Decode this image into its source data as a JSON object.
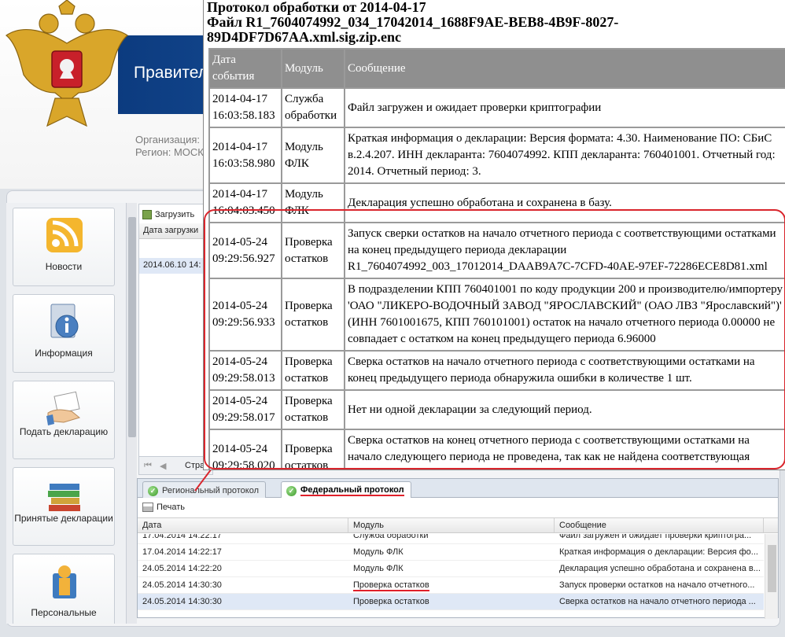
{
  "header": {
    "banner_title": "Правител",
    "org_line": "Организация:",
    "region_line": "Регион: МОСК"
  },
  "sidebar": {
    "items": [
      {
        "label": "Новости",
        "icon": "rss-icon"
      },
      {
        "label": "Информация",
        "icon": "info-icon"
      },
      {
        "label": "Подать декларацию",
        "icon": "hand-document-icon"
      },
      {
        "label": "Принятые декларации",
        "icon": "books-icon"
      },
      {
        "label": "Персональные",
        "icon": "person-icon"
      }
    ]
  },
  "top_grid": {
    "upload_label": "Загрузить",
    "column_header": "Дата загрузки",
    "row_value": "2014.06.10 14:",
    "pager_text": "Стра"
  },
  "bottom_panel": {
    "tabs": [
      {
        "label": "Региональный протокол",
        "active": false
      },
      {
        "label": "Федеральный протокол",
        "active": true
      }
    ],
    "print_label": "Печать",
    "columns": [
      "Дата",
      "Модуль",
      "Сообщение"
    ],
    "rows": [
      {
        "date": "17.04.2014 14:22:17",
        "module": "Служба обработки",
        "message": "Файл загружен и ожидает проверки криптогра..."
      },
      {
        "date": "17.04.2014 14:22:17",
        "module": "Модуль ФЛК",
        "message": "Краткая информация о декларации: Версия фо..."
      },
      {
        "date": "24.05.2014 14:22:20",
        "module": "Модуль ФЛК",
        "message": "Декларация успешно обработана и сохранена в..."
      },
      {
        "date": "24.05.2014 14:30:30",
        "module": "Проверка остатков",
        "message": "Запуск проверки остатков на начало отчетного..."
      },
      {
        "date": "24.05.2014 14:30:30",
        "module": "Проверка остатков",
        "message": "Сверка остатков на начало отчетного периода ..."
      }
    ]
  },
  "popup": {
    "title_line1": "Протокол обработки от 2014-04-17",
    "title_line2": "Файл R1_7604074992_034_17042014_1688F9AE-BEB8-4B9F-8027-",
    "title_line3": "89D4DF7D67AA.xml.sig.zip.enc",
    "columns": [
      "Дата события",
      "Модуль",
      "Сообщение"
    ],
    "rows": [
      {
        "date": "2014-04-17 16:03:58.183",
        "module": "Служба обработки",
        "message": "Файл загружен и ожидает проверки криптографии"
      },
      {
        "date": "2014-04-17 16:03:58.980",
        "module": "Модуль ФЛК",
        "message": "Краткая информация о декларации: Версия формата: 4.30. Наименование ПО: СБиС в.2.4.207. ИНН декларанта: 7604074992. КПП декларанта: 760401001. Отчетный год: 2014. Отчетный период: 3."
      },
      {
        "date": "2014-04-17 16:04:03.450",
        "module": "Модуль ФЛК",
        "message": "Декларация успешно обработана и сохранена в базу."
      },
      {
        "date": "2014-05-24 09:29:56.927",
        "module": "Проверка остатков",
        "message": "Запуск сверки остатков на начало отчетного периода с соответствующими остатками на конец предыдущего периода декларации R1_7604074992_003_17012014_DAAB9A7C-7CFD-40AE-97EF-72286ECE8D81.xml"
      },
      {
        "date": "2014-05-24 09:29:56.933",
        "module": "Проверка остатков",
        "message": "В подразделении КПП 760401001 по коду продукции 200 и производителю/импортеру 'ОАО \"ЛИКЕРО-ВОДОЧНЫЙ ЗАВОД \"ЯРОСЛАВСКИЙ\" (ОАО ЛВЗ \"Ярославский\")' (ИНН 7601001675, КПП 760101001) остаток на начало отчетного периода 0.00000 не совпадает с остатком на конец предыдущего периода 6.96000"
      },
      {
        "date": "2014-05-24 09:29:58.013",
        "module": "Проверка остатков",
        "message": "Сверка остатков на начало отчетного периода с соответствующими остатками на конец предыдущего периода обнаружила ошибки в количестве 1 шт."
      },
      {
        "date": "2014-05-24 09:29:58.017",
        "module": "Проверка остатков",
        "message": "Нет ни одной декларации за следующий период."
      },
      {
        "date": "2014-05-24 09:29:58.020",
        "module": "Проверка остатков",
        "message": "Сверка остатков на конец отчетного периода с соответствующими остатками на начало следующего периода не проведена, так как не найдена соответствующая декларация."
      }
    ]
  },
  "colors": {
    "highlight_red": "#d9252c",
    "banner_blue": "#1d5aa5",
    "table_header_gray": "#8f8f8f"
  }
}
